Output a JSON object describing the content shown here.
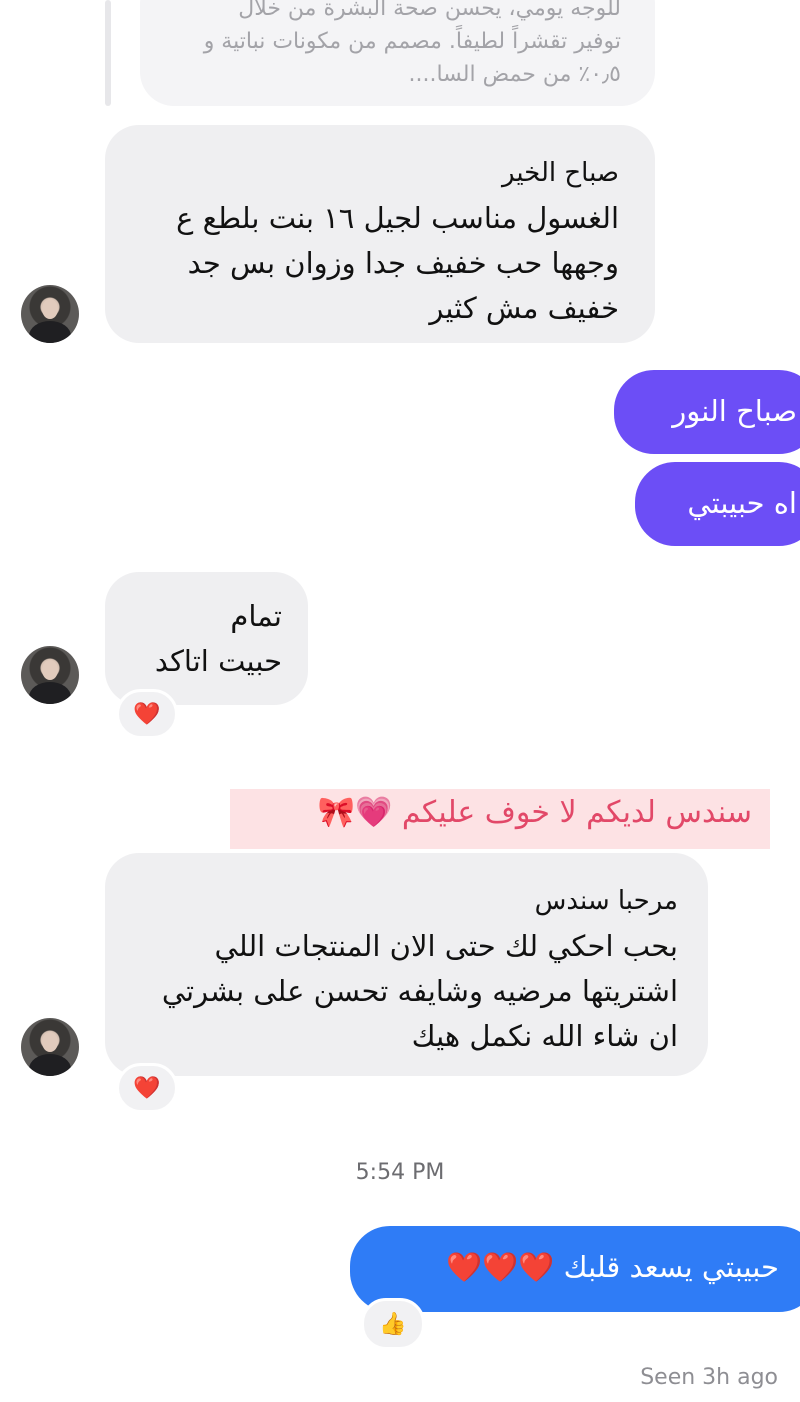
{
  "quoted_message": {
    "lines": [
      "للوجه يومي، يحسن صحة البشرة من خلال",
      "توفير تقشراً لطيفاً. مصمم من مكونات نباتية و",
      "٠٫٥٪ من حمض السا...."
    ]
  },
  "messages": [
    {
      "lines": [
        "صباح الخير",
        "الغسول مناسب لجيل ١٦ بنت بلطع ع",
        "وجهها حب خفيف جدا وزوان بس جد",
        "خفيف مش كثير"
      ]
    },
    {
      "text": "صباح النور"
    },
    {
      "text": "اه حبيبتي"
    },
    {
      "lines": [
        "تمام",
        "حبيت اتاكد"
      ],
      "reaction": "❤️"
    },
    {
      "text": "سندس لديكم لا خوف عليكم 💗🎀"
    },
    {
      "lines": [
        "مرحبا سندس",
        "بحب احكي لك حتى الان المنتجات اللي",
        "اشتريتها مرضيه وشايفه تحسن على بشرتي",
        "ان شاء الله نكمل هيك"
      ],
      "reaction": "❤️"
    },
    {
      "text": "حبيبتي يسعد قلبك ❤️❤️❤️",
      "reaction": "👍"
    }
  ],
  "timestamp": "5:54 PM",
  "seen": "Seen 3h ago",
  "colors": {
    "outgoing_purple": "#6c4ef6",
    "outgoing_blue": "#2f7cf6",
    "incoming_bubble": "#efeff1",
    "banner_bg": "#fde2e4",
    "banner_text": "#e24868"
  },
  "icons": {
    "heart_reaction": "red-heart-icon",
    "thumbs_up_reaction": "thumbs-up-icon",
    "avatar": "contact-avatar"
  }
}
